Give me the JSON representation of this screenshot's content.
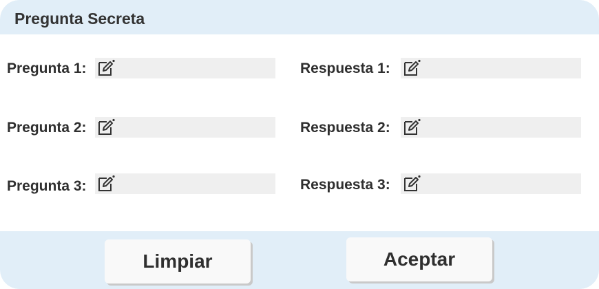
{
  "header": {
    "title": "Pregunta Secreta"
  },
  "questions": [
    {
      "label": "Pregunta 1:",
      "value": ""
    },
    {
      "label": "Pregunta 2:",
      "value": ""
    },
    {
      "label": "Pregunta 3:",
      "value": ""
    }
  ],
  "answers": [
    {
      "label": "Respuesta 1:",
      "value": ""
    },
    {
      "label": "Respuesta 2:",
      "value": ""
    },
    {
      "label": "Respuesta 3:",
      "value": ""
    }
  ],
  "icons": {
    "field_icon": "edit-icon"
  },
  "colors": {
    "header_bg": "#e1eef8",
    "field_bg": "#efefef",
    "text": "#2f2f2f"
  },
  "buttons": {
    "clear_label": "Limpiar",
    "accept_label": "Aceptar"
  }
}
